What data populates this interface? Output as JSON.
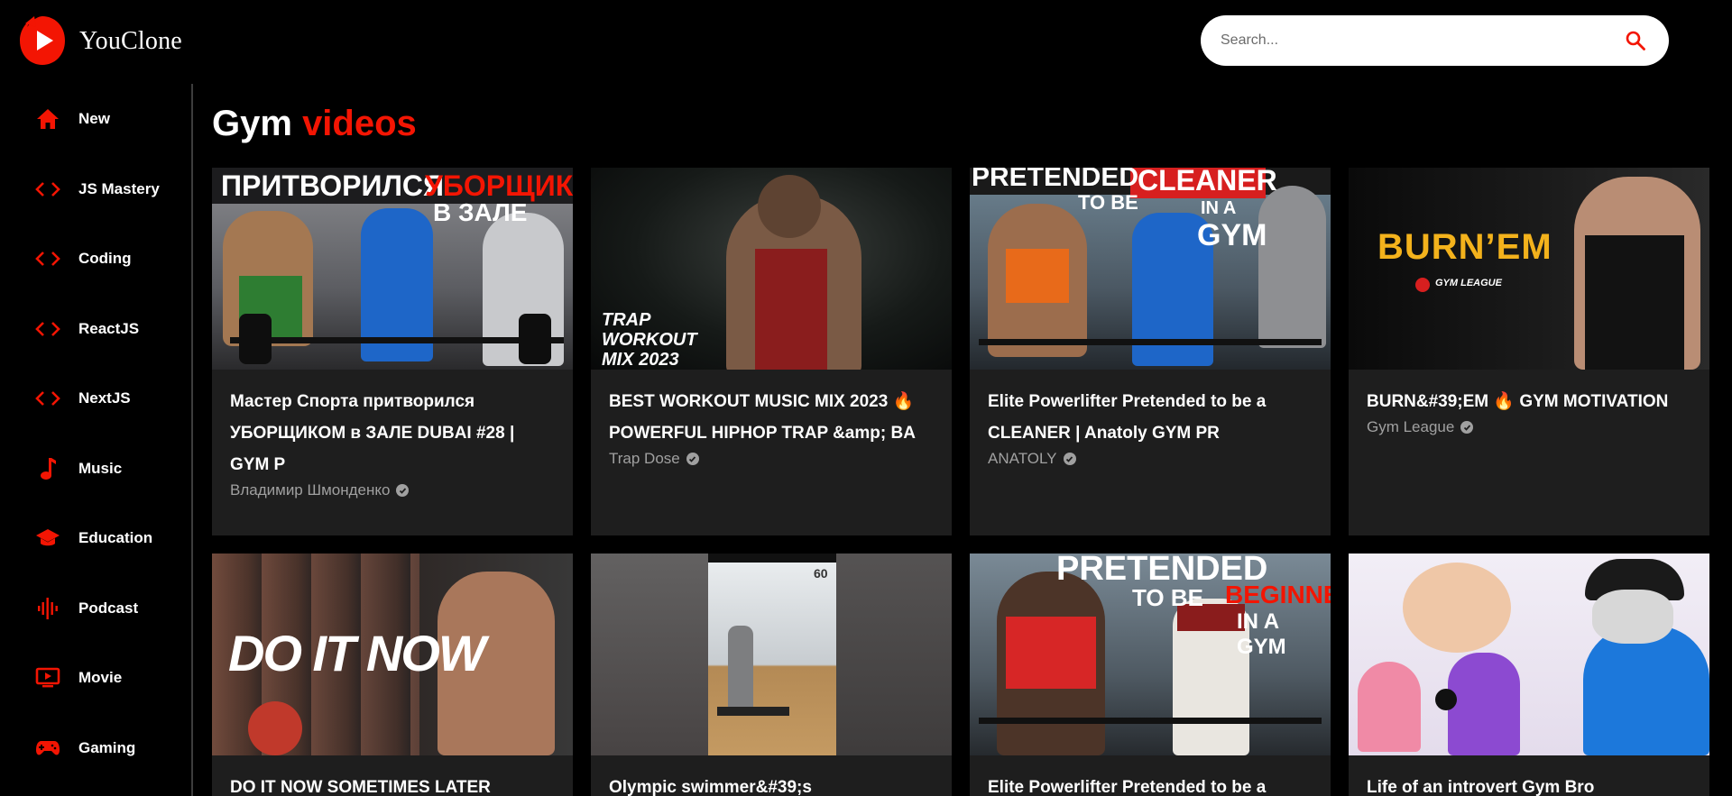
{
  "app": {
    "name": "YouClone"
  },
  "colors": {
    "accent": "#f31503",
    "card_bg": "#1e1e1e",
    "page_bg": "#000000"
  },
  "search": {
    "placeholder": "Search..."
  },
  "sidebar": {
    "items": [
      {
        "label": "New",
        "icon": "home-icon"
      },
      {
        "label": "JS Mastery",
        "icon": "code-icon"
      },
      {
        "label": "Coding",
        "icon": "code-icon"
      },
      {
        "label": "ReactJS",
        "icon": "code-icon"
      },
      {
        "label": "NextJS",
        "icon": "code-icon"
      },
      {
        "label": "Music",
        "icon": "music-note-icon"
      },
      {
        "label": "Education",
        "icon": "graduation-cap-icon"
      },
      {
        "label": "Podcast",
        "icon": "podcast-icon"
      },
      {
        "label": "Movie",
        "icon": "tv-icon"
      },
      {
        "label": "Gaming",
        "icon": "gamepad-icon"
      }
    ]
  },
  "feed": {
    "title_prefix": "Gym",
    "title_accent": "videos",
    "videos": [
      {
        "title": "Мастер Спорта притворился УБОРЩИКОМ в ЗАЛЕ DUBAI #28 | GYM P",
        "channel": "Владимир Шмонденко",
        "thumb_text": [
          "ПРИТВОРИЛСЯ",
          "УБОРЩИКОМ",
          "В ЗАЛЕ"
        ]
      },
      {
        "title": "BEST WORKOUT MUSIC MIX 2023 🔥 POWERFUL HIPHOP TRAP &amp; BA",
        "channel": "Trap Dose",
        "thumb_text": [
          "TRAP",
          "WORKOUT",
          "MIX 2023"
        ]
      },
      {
        "title": "Elite Powerlifter Pretended to be a CLEANER | Anatoly GYM PR",
        "channel": "ANATOLY",
        "thumb_text": [
          "PRETENDED",
          "TO BE",
          "CLEANER",
          "IN A",
          "GYM"
        ]
      },
      {
        "title": "BURN&#39;EM 🔥 GYM MOTIVATION",
        "channel": "Gym League",
        "thumb_text": [
          "BURN’EM",
          "GYM LEAGUE"
        ]
      },
      {
        "title": "DO IT NOW SOMETIMES LATER",
        "channel": "",
        "thumb_text": [
          "DO IT NOW"
        ]
      },
      {
        "title": "Olympic swimmer&#39;s",
        "channel": "",
        "thumb_text": [
          "60"
        ]
      },
      {
        "title": "Elite Powerlifter Pretended to be a",
        "channel": "",
        "thumb_text": [
          "PRETENDED",
          "TO BE",
          "BEGINNER",
          "IN A GYM"
        ]
      },
      {
        "title": "Life of an introvert Gym Bro",
        "channel": "",
        "thumb_text": []
      }
    ]
  }
}
